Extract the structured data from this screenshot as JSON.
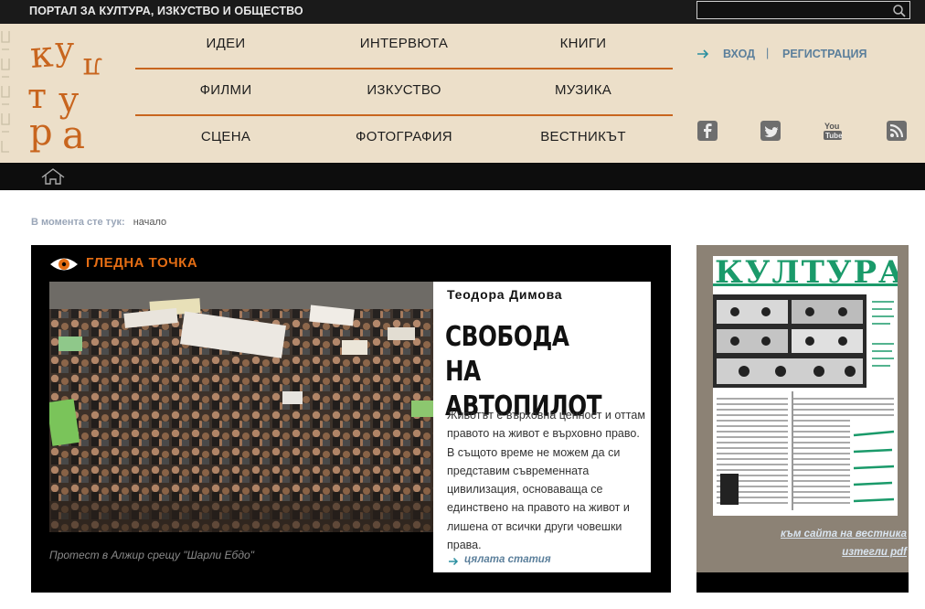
{
  "portal": {
    "title": "ПОРТАЛ ЗА КУЛТУРА, ИЗКУСТВО И ОБЩЕСТВО"
  },
  "search": {
    "placeholder": ""
  },
  "logo": {
    "text": "култура"
  },
  "nav": {
    "row1": [
      "ИДЕИ",
      "ИНТЕРВЮТА",
      "КНИГИ"
    ],
    "row2": [
      "ФИЛМИ",
      "ИЗКУСТВО",
      "МУЗИКА"
    ],
    "row3": [
      "СЦЕНА",
      "ФОТОГРАФИЯ",
      "ВЕСТНИКЪТ"
    ]
  },
  "account": {
    "login": "ВХОД",
    "separator": "|",
    "register": "РЕГИСТРАЦИЯ"
  },
  "social": [
    "facebook-icon",
    "twitter-icon",
    "youtube-icon",
    "rss-icon"
  ],
  "breadcrumb": {
    "label": "В момента сте тук:",
    "current": "начало"
  },
  "feature": {
    "section": "ГЛЕДНА ТОЧКА",
    "author": "Теодора Димова",
    "title_line1": "СВОБОДА НА",
    "title_line2": "АВТОПИЛОТ",
    "excerpt": "Животът е върховна ценност и оттам правото на живот е върховно право. В същото време не можем да си представим съвременната цивилизация, основаваща се единствено на правото на живот и лишена от всички други човешки права.",
    "more": "цялата статия",
    "caption": "Протест в Алжир срещу \"Шарли Ебдо\""
  },
  "newspaper": {
    "masthead": "КУЛТУРА",
    "link_site": "към сайта на вестника",
    "link_pdf": "изтегли pdf"
  },
  "colors": {
    "accent": "#c8651e",
    "header_bg": "#ecdfc9",
    "link": "#5b7f9b"
  }
}
